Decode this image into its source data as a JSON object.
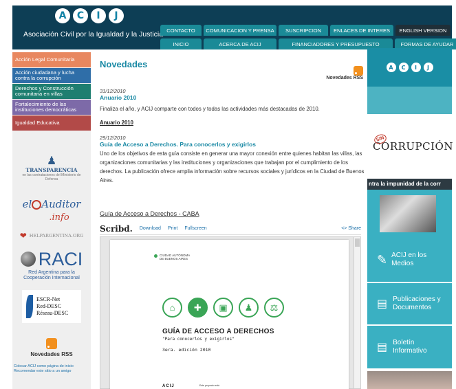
{
  "header": {
    "logo_letters": [
      "A",
      "C",
      "I",
      "J"
    ],
    "org_name": "Asociación Civil por la Igualdad y la Justicia",
    "nav_row1": [
      "CONTACTO",
      "COMUNICACION Y PRENSA",
      "SUSCRIPCION",
      "ENLACES DE INTERES",
      "ENGLISH VERSION"
    ],
    "nav_row2": [
      "INICIO",
      "ACERCA DE ACIJ",
      "FINANCIADORES Y PRESUPUESTO",
      "FORMAS DE AYUDAR"
    ]
  },
  "sidebar": {
    "items": [
      {
        "label": "Acción Legal Comunitaria",
        "color": "#e8875f"
      },
      {
        "label": "Acción ciudadana y lucha contra la corrupción",
        "color": "#2f6ea8"
      },
      {
        "label": "Derechos y Construcción comunitaria en villas",
        "color": "#1e7e70"
      },
      {
        "label": "Fortalecimiento de las instituciones democráticas",
        "color": "#7d6aa8"
      },
      {
        "label": "Igualdad Educativa",
        "color": "#b24a48"
      }
    ],
    "transparencia_title": "TRANSPARENCIA",
    "transparencia_sub": "en las contrataciones del Ministerio de Defensa",
    "auditor_a": "el",
    "auditor_b": "Auditor",
    "auditor_c": ".info",
    "helpargentina": "HELPARGENTINA.ORG",
    "raci_title": "RACI",
    "raci_sub": "Red Argentina para la Cooperación Internacional",
    "escr_lines": [
      "ESCR-Net",
      "Red-DESC",
      "Réseau-DESC"
    ],
    "rss_label": "Novedades RSS",
    "footer_link": "Colocar ACIJ como página de inicio",
    "footer_link2": "Recomendar este sitio a un amigo"
  },
  "main": {
    "title": "Novedades",
    "rss_label": "Novedades RSS",
    "news": [
      {
        "date": "31/12/2010",
        "title": "Anuario 2010",
        "body": "Finaliza el año, y ACIJ comparte con todos y todas las actividades más destacadas de 2010.",
        "link": "Anuario 2010"
      },
      {
        "date": "29/12/2010",
        "title": "Guía de Acceso a Derechos. Para conocerlos y exigirlos",
        "body": "Uno de los objetivos de esta guía consiste en generar una mayor conexión entre quienes habitan las villas, las organizaciones comunitarias y las instituciones y organizaciones que trabajan por el cumplimiento de los derechos. La publicación ofrece amplia información sobre recursos sociales y jurídicos en la Ciudad de Buenos Aires."
      }
    ],
    "embed_title": "Guía de Acceso a Derechos - CABA",
    "scribd": {
      "logo": "Scribd.",
      "download": "Download",
      "print": "Print",
      "fullscreen": "Fullscreen",
      "share": "<> Share"
    },
    "doc": {
      "city_label_1": "CIUDAD AUTÓNOMA",
      "city_label_2": "DE BUENOS AIRES",
      "heading": "GUÍA DE ACCESO A DERECHOS",
      "sub": "\"Para conocerlos y exigirlos\"",
      "edition": "3era. edición 2010",
      "footer_logo": "ACIJ",
      "footer_note": "Este proyecto está"
    }
  },
  "right": {
    "acij_letters": [
      "A",
      "C",
      "I",
      "J"
    ],
    "corrupcion_sin": "SIN",
    "corrupcion_text": "CORRUPCIÓN",
    "impunidad": "ntra la impunidad de la corr",
    "medios": "ACIJ en los Medios",
    "publicaciones": "Publicaciones y Documentos",
    "boletin": "Boletín Informativo"
  }
}
